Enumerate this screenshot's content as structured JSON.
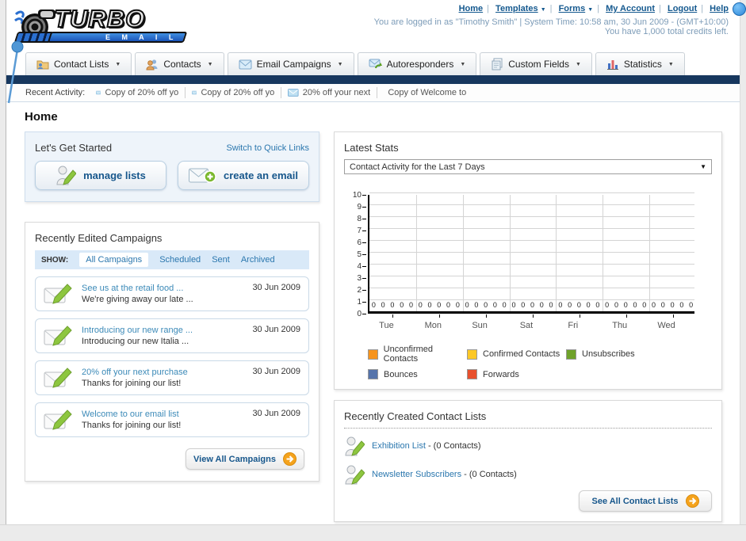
{
  "colors": {
    "accent_blue": "#2b77ae",
    "navy_bar": "#17375e",
    "link_dark": "#15598f",
    "orange_action": "#f5a31c"
  },
  "header": {
    "logo_title": "TURBO",
    "logo_subtitle": "E M A I L",
    "nav_links": [
      "Home",
      "Templates",
      "Forms",
      "My Account",
      "Logout",
      "Help"
    ],
    "login_info": "You are logged in as \"Timothy Smith\" | System Time: 10:58 am, 30 Jun 2009 - (GMT+10:00)",
    "credits_info": "You have 1,000 total credits left."
  },
  "main_nav": {
    "tabs": [
      {
        "label": "Contact Lists",
        "icon": "contact-lists-folder-icon"
      },
      {
        "label": "Contacts",
        "icon": "contacts-people-icon"
      },
      {
        "label": "Email Campaigns",
        "icon": "email-envelope-icon"
      },
      {
        "label": "Autoresponders",
        "icon": "autoresponder-envelope-icon"
      },
      {
        "label": "Custom Fields",
        "icon": "custom-fields-pages-icon"
      },
      {
        "label": "Statistics",
        "icon": "statistics-chart-icon"
      }
    ]
  },
  "recent_activity": {
    "label": "Recent Activity:",
    "items": [
      "Copy of 20% off yo",
      "Copy of 20% off yo",
      "20% off your next",
      "Copy of Welcome to"
    ]
  },
  "home": {
    "title": "Home",
    "get_started": {
      "title": "Let's Get Started",
      "switch_link": "Switch to Quick Links",
      "manage_lists_label": "manage lists",
      "create_email_label": "create an email"
    },
    "campaigns_panel": {
      "title": "Recently Edited Campaigns",
      "show_label": "SHOW:",
      "tabs": [
        "All Campaigns",
        "Scheduled",
        "Sent",
        "Archived"
      ],
      "active_tab": "All Campaigns",
      "items": [
        {
          "title": "See us at the retail food ...",
          "subtitle": "We're giving away our late ...",
          "date": "30 Jun 2009"
        },
        {
          "title": "Introducing our new range ...",
          "subtitle": "Introducing our new Italia ...",
          "date": "30 Jun 2009"
        },
        {
          "title": "20% off your next purchase",
          "subtitle": "Thanks for joining our list!",
          "date": "30 Jun 2009"
        },
        {
          "title": "Welcome to our email list",
          "subtitle": "Thanks for joining our list!",
          "date": "30 Jun 2009"
        }
      ],
      "view_all_label": "View All Campaigns"
    },
    "stats_panel": {
      "title": "Latest Stats",
      "dropdown_value": "Contact Activity for the Last 7 Days"
    },
    "contact_lists_panel": {
      "title": "Recently Created Contact Lists",
      "items": [
        {
          "name": "Exhibition List",
          "detail": "- (0 Contacts)"
        },
        {
          "name": "Newsletter Subscribers",
          "detail": "- (0 Contacts)"
        }
      ],
      "see_all_label": "See All Contact Lists"
    }
  },
  "chart_data": {
    "type": "bar",
    "title": "Contact Activity for the Last 7 Days",
    "categories": [
      "Tue",
      "Mon",
      "Sun",
      "Sat",
      "Fri",
      "Thu",
      "Wed"
    ],
    "series": [
      {
        "name": "Unconfirmed Contacts",
        "color": "#f7941d",
        "values": [
          0,
          0,
          0,
          0,
          0,
          0,
          0
        ]
      },
      {
        "name": "Confirmed Contacts",
        "color": "#fdc826",
        "values": [
          0,
          0,
          0,
          0,
          0,
          0,
          0
        ]
      },
      {
        "name": "Unsubscribes",
        "color": "#6fa22a",
        "values": [
          0,
          0,
          0,
          0,
          0,
          0,
          0
        ]
      },
      {
        "name": "Bounces",
        "color": "#5674ab",
        "values": [
          0,
          0,
          0,
          0,
          0,
          0,
          0
        ]
      },
      {
        "name": "Forwards",
        "color": "#e8502d",
        "values": [
          0,
          0,
          0,
          0,
          0,
          0,
          0
        ]
      }
    ],
    "xlabel": "",
    "ylabel": "",
    "ylim": [
      0,
      10
    ],
    "yticks": [
      0,
      1,
      2,
      3,
      4,
      5,
      6,
      7,
      8,
      9,
      10
    ],
    "grid": true,
    "legend_position": "bottom",
    "value_labels_shown": true
  }
}
